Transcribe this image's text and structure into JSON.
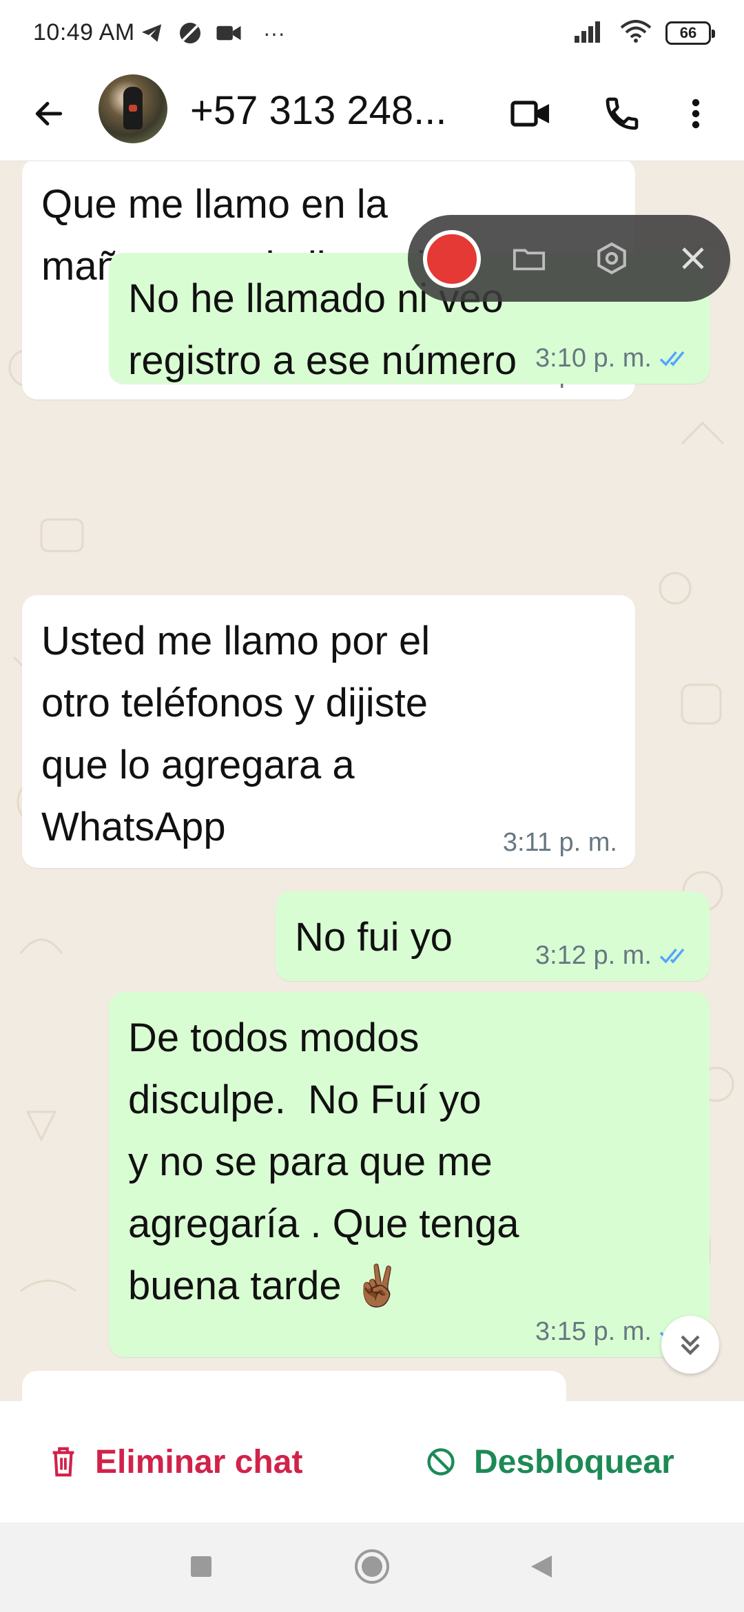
{
  "status_bar": {
    "time": "10:49 AM",
    "more": "···",
    "battery": "66",
    "icons": [
      "telegram-icon",
      "circle-slash-icon",
      "video-camera-icon",
      "signal-icon",
      "wifi-icon",
      "battery-icon"
    ]
  },
  "header": {
    "contact_name": "+57 313 248...",
    "icons": [
      "back-arrow-icon",
      "avatar",
      "video-call-icon",
      "voice-call-icon",
      "more-vert-icon"
    ]
  },
  "messages": [
    {
      "direction": "in",
      "text": "Que me llamo en la\nmañana por la llamada",
      "time": "3:08 p. m."
    },
    {
      "direction": "out",
      "text": "No he llamado ni veo\nregistro a ese número",
      "time": "3:10 p. m.",
      "status": "read"
    },
    {
      "direction": "in",
      "text": "Usted me llamo por el\notro teléfonos y dijiste\nque lo agregara a\nWhatsApp",
      "time": "3:11 p. m."
    },
    {
      "direction": "out",
      "text": "No fui yo",
      "time": "3:12 p. m.",
      "status": "read"
    },
    {
      "direction": "out",
      "text": "De todos modos\ndisculpe.  No Fuí yo\ny no se para que me\nagregaría . Que tenga\nbuena tarde ✌🏾",
      "time": "3:15 p. m.",
      "status": "read"
    }
  ],
  "recording_overlay": {
    "icons": [
      "record-icon",
      "folder-icon",
      "settings-hex-icon",
      "close-icon"
    ]
  },
  "actions": {
    "delete_label": "Eliminar chat",
    "unblock_label": "Desbloquear"
  },
  "colors": {
    "incoming_bubble": "#ffffff",
    "outgoing_bubble": "#d9fdd3",
    "read_ticks": "#53a6fd",
    "delete_red": "#d1224a",
    "unblock_green": "#1d8a56",
    "record_red": "#e53935"
  },
  "nav": {
    "icons": [
      "recents-square-icon",
      "home-circle-icon",
      "back-triangle-icon"
    ]
  }
}
